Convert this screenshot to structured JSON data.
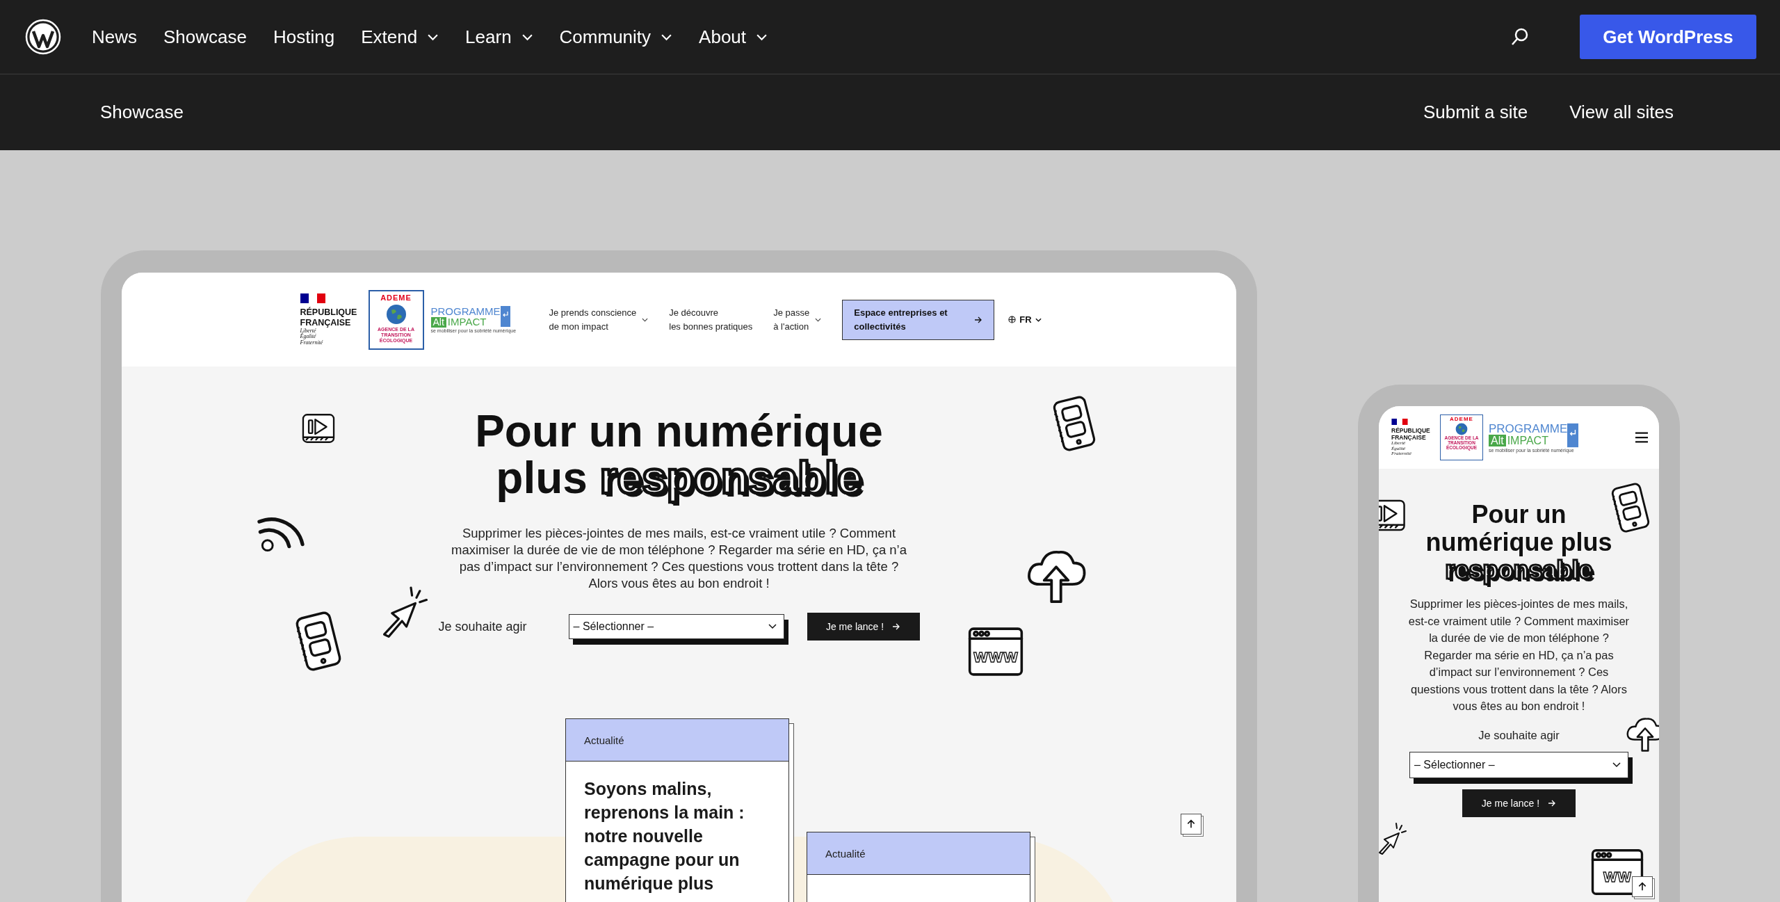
{
  "top_nav": {
    "items": [
      {
        "label": "News",
        "has_menu": false
      },
      {
        "label": "Showcase",
        "has_menu": false
      },
      {
        "label": "Hosting",
        "has_menu": false
      },
      {
        "label": "Extend",
        "has_menu": true
      },
      {
        "label": "Learn",
        "has_menu": true
      },
      {
        "label": "Community",
        "has_menu": true
      },
      {
        "label": "About",
        "has_menu": true
      }
    ],
    "button": "Get WordPress"
  },
  "sub_nav": {
    "title": "Showcase",
    "links": [
      "Submit a site",
      "View all sites"
    ]
  },
  "desktop_preview": {
    "header": {
      "gov_logo": {
        "name": "RÉPUBLIQUE FRANÇAISE",
        "motto": [
          "Liberté",
          "Égalité",
          "Fraternité"
        ]
      },
      "agency_logo": {
        "name": "ADEME",
        "subtitle": "AGENCE DE LA TRANSITION ÉCOLOGIQUE"
      },
      "program_logo": {
        "line_1": "PROGRAMME",
        "tag": "Alt",
        "word": "IMPACT",
        "tagline": "se mobiliser pour la sobriété numérique"
      },
      "menu": [
        {
          "label_lines": [
            "Je prends conscience",
            "de mon impact"
          ],
          "has_menu": true
        },
        {
          "label_lines": [
            "Je découvre",
            "les bonnes pratiques"
          ],
          "has_menu": false
        },
        {
          "label_lines": [
            "Je passe",
            "à l'action"
          ],
          "has_menu": true
        }
      ],
      "cta": "Espace entreprises et collectivités",
      "language": "FR"
    },
    "hero": {
      "title": "Pour un numérique plus",
      "highlight": "responsable",
      "intro": "Supprimer les pièces-jointes de mes mails, est-ce vraiment utile ? Comment maximiser la durée de vie de mon téléphone ? Regarder ma série en HD, ça n’a pas d’impact sur l’environnement ? Ces questions vous trottent dans la tête ? Alors vous êtes au bon endroit !",
      "action_label": "Je souhaite agir",
      "select_value": "– Sélectionner –",
      "button": "Je me lance !",
      "www_label": "WWW"
    },
    "cards": [
      {
        "tag": "Actualité",
        "title": "Soyons malins, reprenons la main : notre nouvelle campagne pour un numérique plus"
      },
      {
        "tag": "Actualité"
      }
    ]
  },
  "mobile_preview": {
    "header": {
      "gov_logo": {
        "name": "RÉPUBLIQUE FRANÇAISE",
        "motto": [
          "Liberté",
          "Égalité",
          "Fraternité"
        ]
      },
      "agency_logo": {
        "name": "ADEME",
        "subtitle": "AGENCE DE LA TRANSITION ÉCOLOGIQUE"
      },
      "program_logo": {
        "line_1": "PROGRAMME",
        "tag": "Alt",
        "word": "IMPACT",
        "tagline": "se mobiliser pour la sobriété numérique"
      }
    },
    "hero": {
      "title": "Pour un numérique plus",
      "highlight": "responsable",
      "intro": "Supprimer les pièces-jointes de mes mails, est-ce vraiment utile ? Comment maximiser la durée de vie de mon téléphone ? Regarder ma série en HD, ça n’a pas d’impact sur l’environnement ? Ces questions vous trottent dans la tête ? Alors vous êtes au bon endroit !",
      "action_label": "Je souhaite agir",
      "select_value": "– Sélectionner –",
      "button": "Je me lance !",
      "www_label": "WW"
    }
  }
}
